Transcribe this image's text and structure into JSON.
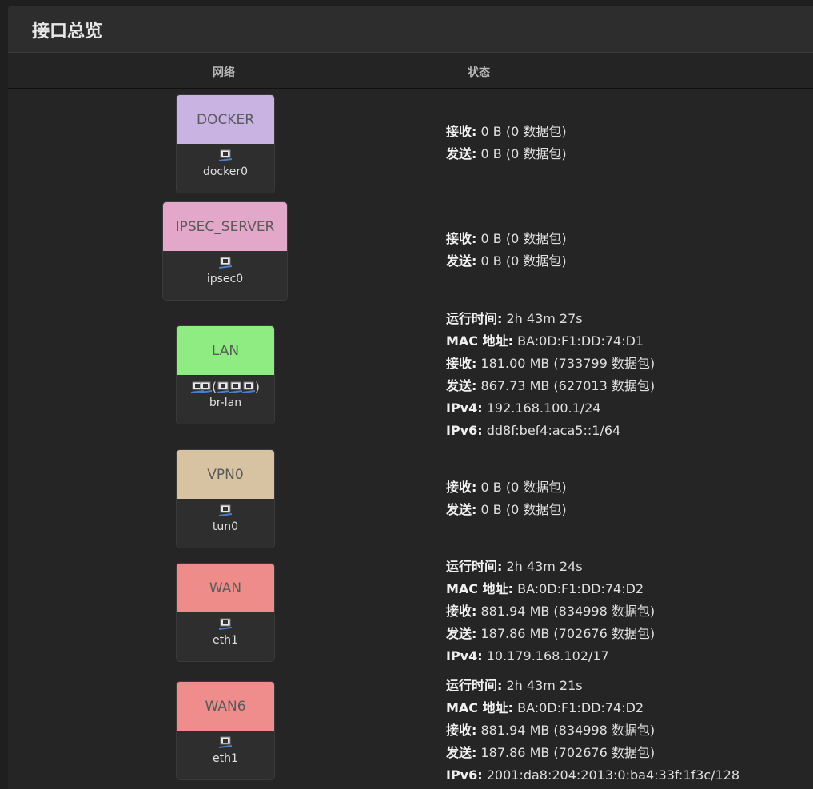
{
  "header": {
    "title": "接口总览"
  },
  "table": {
    "col_network": "网络",
    "col_status": "状态"
  },
  "interfaces": [
    {
      "name": "DOCKER",
      "device": "docker0",
      "color": "#c9b3e3",
      "status": [
        {
          "label": "接收:",
          "value": "0 B (0 数据包)"
        },
        {
          "label": "发送:",
          "value": "0 B (0 数据包)"
        }
      ]
    },
    {
      "name": "IPSEC_SERVER",
      "device": "ipsec0",
      "color": "#e3a7c9",
      "status": [
        {
          "label": "接收:",
          "value": "0 B (0 数据包)"
        },
        {
          "label": "发送:",
          "value": "0 B (0 数据包)"
        }
      ]
    },
    {
      "name": "LAN",
      "device": "br-lan",
      "color": "#8fec83",
      "bridge_label": "(   )",
      "status": [
        {
          "label": "运行时间:",
          "value": "2h 43m 27s"
        },
        {
          "label": "MAC 地址:",
          "value": "BA:0D:F1:DD:74:D1"
        },
        {
          "label": "接收:",
          "value": "181.00 MB (733799 数据包)"
        },
        {
          "label": "发送:",
          "value": "867.73 MB (627013 数据包)"
        },
        {
          "label": "IPv4:",
          "value": "192.168.100.1/24"
        },
        {
          "label": "IPv6:",
          "value": "dd8f:bef4:aca5::1/64"
        }
      ]
    },
    {
      "name": "VPN0",
      "device": "tun0",
      "color": "#d7c3a2",
      "status": [
        {
          "label": "接收:",
          "value": "0 B (0 数据包)"
        },
        {
          "label": "发送:",
          "value": "0 B (0 数据包)"
        }
      ]
    },
    {
      "name": "WAN",
      "device": "eth1",
      "color": "#ee8c89",
      "status": [
        {
          "label": "运行时间:",
          "value": "2h 43m 24s"
        },
        {
          "label": "MAC 地址:",
          "value": "BA:0D:F1:DD:74:D2"
        },
        {
          "label": "接收:",
          "value": "881.94 MB (834998 数据包)"
        },
        {
          "label": "发送:",
          "value": "187.86 MB (702676 数据包)"
        },
        {
          "label": "IPv4:",
          "value": "10.179.168.102/17"
        }
      ]
    },
    {
      "name": "WAN6",
      "device": "eth1",
      "color": "#ef8c8c",
      "status": [
        {
          "label": "运行时间:",
          "value": "2h 43m 21s"
        },
        {
          "label": "MAC 地址:",
          "value": "BA:0D:F1:DD:74:D2"
        },
        {
          "label": "接收:",
          "value": "881.94 MB (834998 数据包)"
        },
        {
          "label": "发送:",
          "value": "187.86 MB (702676 数据包)"
        },
        {
          "label": "IPv6:",
          "value": "2001:da8:204:2013:0:ba4:33f:1f3c/128"
        }
      ]
    }
  ]
}
